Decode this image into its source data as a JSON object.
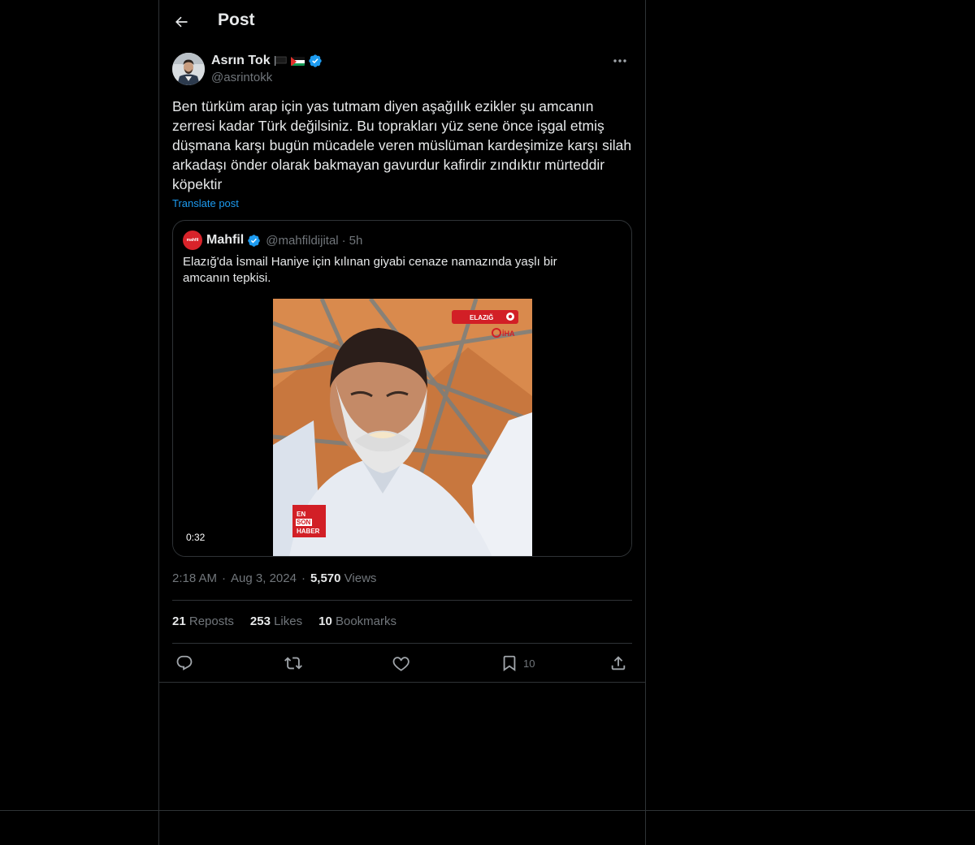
{
  "header": {
    "title": "Post"
  },
  "author": {
    "name": "Asrın Tok",
    "handle": "@asrintokk",
    "verified": true,
    "flags": [
      "black-flag",
      "palestine-flag"
    ]
  },
  "tweet": {
    "text": "Ben türküm arap için yas tutmam diyen aşağılık ezikler şu amcanın zerresi kadar Türk değilsiniz. Bu toprakları yüz sene önce işgal etmiş düşmana karşı bugün mücadele veren müslüman kardeşimize karşı silah arkadaşı önder olarak bakmayan gavurdur kafirdir zındıktır mürteddir köpektir",
    "translate_label": "Translate post"
  },
  "quote": {
    "avatar_text": "mahfil",
    "name": "Mahfil",
    "handle": "@mahfildijital",
    "dot": "·",
    "time": "5h",
    "text": "Elazığ'da İsmail Haniye için kılınan giyabi cenaze namazında yaşlı bir amcanın tepkisi.",
    "video": {
      "duration": "0:32",
      "location_tag": "ELAZIĞ",
      "agency": "İHA",
      "logo_lines": [
        "EN",
        "SON",
        "HABER"
      ]
    }
  },
  "meta": {
    "time": "2:18 AM",
    "sep1": "·",
    "date": "Aug 3, 2024",
    "sep2": "·",
    "views": "5,570",
    "views_label": "Views"
  },
  "stats": {
    "reposts": "21",
    "reposts_label": "Reposts",
    "likes": "253",
    "likes_label": "Likes",
    "bookmarks": "10",
    "bookmarks_label": "Bookmarks"
  },
  "actions": {
    "bookmark_count": "10"
  },
  "colors": {
    "background": "#000000",
    "text": "#e7e9ea",
    "muted": "#71767b",
    "border": "#2f3336",
    "accent": "#1d9bf0"
  },
  "icons": [
    "back-arrow-icon",
    "verified-badge-icon",
    "more-icon",
    "reply-icon",
    "repost-icon",
    "like-icon",
    "bookmark-icon",
    "share-icon"
  ]
}
